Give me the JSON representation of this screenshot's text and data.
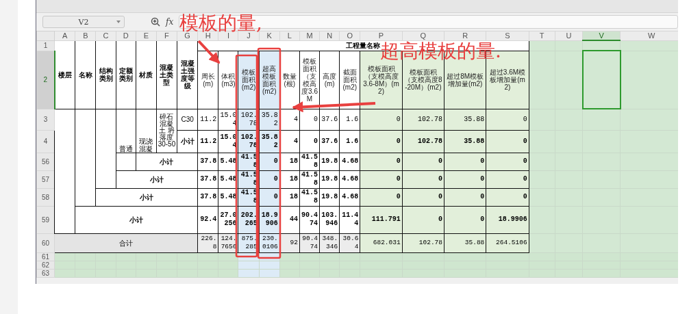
{
  "formula_bar": {
    "name_box": "V2",
    "fx_label": "fx"
  },
  "columns": [
    {
      "label": "A",
      "selected": false
    },
    {
      "label": "B",
      "selected": false
    },
    {
      "label": "C",
      "selected": false
    },
    {
      "label": "D",
      "selected": false
    },
    {
      "label": "E",
      "selected": false
    },
    {
      "label": "F",
      "selected": false
    },
    {
      "label": "G",
      "selected": false
    },
    {
      "label": "H",
      "selected": false
    },
    {
      "label": "I",
      "selected": false
    },
    {
      "label": "J",
      "selected": false
    },
    {
      "label": "K",
      "selected": false
    },
    {
      "label": "L",
      "selected": false
    },
    {
      "label": "M",
      "selected": false
    },
    {
      "label": "N",
      "selected": false
    },
    {
      "label": "O",
      "selected": false
    },
    {
      "label": "P",
      "selected": false
    },
    {
      "label": "Q",
      "selected": false
    },
    {
      "label": "R",
      "selected": false
    },
    {
      "label": "S",
      "selected": false
    },
    {
      "label": "T",
      "selected": false
    },
    {
      "label": "U",
      "selected": false
    },
    {
      "label": "V",
      "selected": true
    },
    {
      "label": "W",
      "selected": false
    }
  ],
  "row_numbers": [
    {
      "label": "1",
      "selected": false
    },
    {
      "label": "2",
      "selected": true
    },
    {
      "label": "3",
      "selected": false
    },
    {
      "label": "4",
      "selected": false
    },
    {
      "label": "56",
      "selected": false
    },
    {
      "label": "57",
      "selected": false
    },
    {
      "label": "58",
      "selected": false
    },
    {
      "label": "59",
      "selected": false
    },
    {
      "label": "60",
      "selected": false
    },
    {
      "label": "61",
      "selected": false
    },
    {
      "label": "62",
      "selected": false
    },
    {
      "label": "63",
      "selected": false
    }
  ],
  "header": {
    "fixed": [
      "楼层",
      "名称",
      "结构类别",
      "定额类别",
      "材质",
      "混凝土类型",
      "混凝土强度等级"
    ],
    "group_title": "工程量名称",
    "measures": [
      "周长(m)",
      "体积(m3)",
      "模板面积(m2)",
      "超高模板面积(m2)",
      "数量(根)",
      "模板面积（支模高度3.6M",
      "高度(m)",
      "截面面积(m2)",
      "模板面积（支模高度3.6-8M）(m2)",
      "模板面积（支模高度8-20M）(m2)",
      "超过8M模板增加量(m2)",
      "超过3.6M模板增加量(m2)"
    ]
  },
  "rows": [
    {
      "kind": "detail",
      "labels": [
        "普通",
        "现浇混凝",
        "碎石混凝土 坍落度30-50",
        "C30"
      ],
      "values": [
        "11.2",
        "15.04",
        "102.78",
        "35.82",
        "4",
        "0",
        "37.6",
        "1.6",
        "0",
        "102.78",
        "35.88",
        "0"
      ]
    },
    {
      "kind": "subtotal",
      "labels": [
        "小计"
      ],
      "values": [
        "11.2",
        "15.04",
        "102.78",
        "35.82",
        "4",
        "0",
        "37.6",
        "1.6",
        "0",
        "102.78",
        "35.88",
        "0"
      ]
    },
    {
      "kind": "subtotal",
      "labels": [
        "小计"
      ],
      "values": [
        "37.8",
        "5.48",
        "41.58",
        "0",
        "18",
        "41.58",
        "19.8",
        "4.68",
        "0",
        "0",
        "0",
        "0"
      ]
    },
    {
      "kind": "subtotal",
      "labels": [
        "小计"
      ],
      "values": [
        "37.8",
        "5.48",
        "41.58",
        "0",
        "18",
        "41.58",
        "19.8",
        "4.68",
        "0",
        "0",
        "0",
        "0"
      ]
    },
    {
      "kind": "subtotal",
      "labels": [
        "小计"
      ],
      "values": [
        "37.8",
        "5.48",
        "41.58",
        "0",
        "18",
        "41.58",
        "19.8",
        "4.68",
        "0",
        "0",
        "0",
        "0"
      ]
    },
    {
      "kind": "subtotal",
      "labels": [
        "小计"
      ],
      "values": [
        "92.4",
        "27.0256",
        "202.265",
        "18.9906",
        "44",
        "90.474",
        "103.946",
        "11.44",
        "111.791",
        "0",
        "0",
        "18.9906"
      ]
    },
    {
      "kind": "total",
      "labels": [
        "合计"
      ],
      "values": [
        "226.8",
        "124.7656",
        "875.285",
        "230.0106",
        "92",
        "90.474",
        "348.346",
        "30.64",
        "682.031",
        "102.78",
        "35.88",
        "264.5106"
      ]
    }
  ],
  "annotations": [
    {
      "text": "模板的量,"
    },
    {
      "text": "超高模板的量."
    }
  ]
}
